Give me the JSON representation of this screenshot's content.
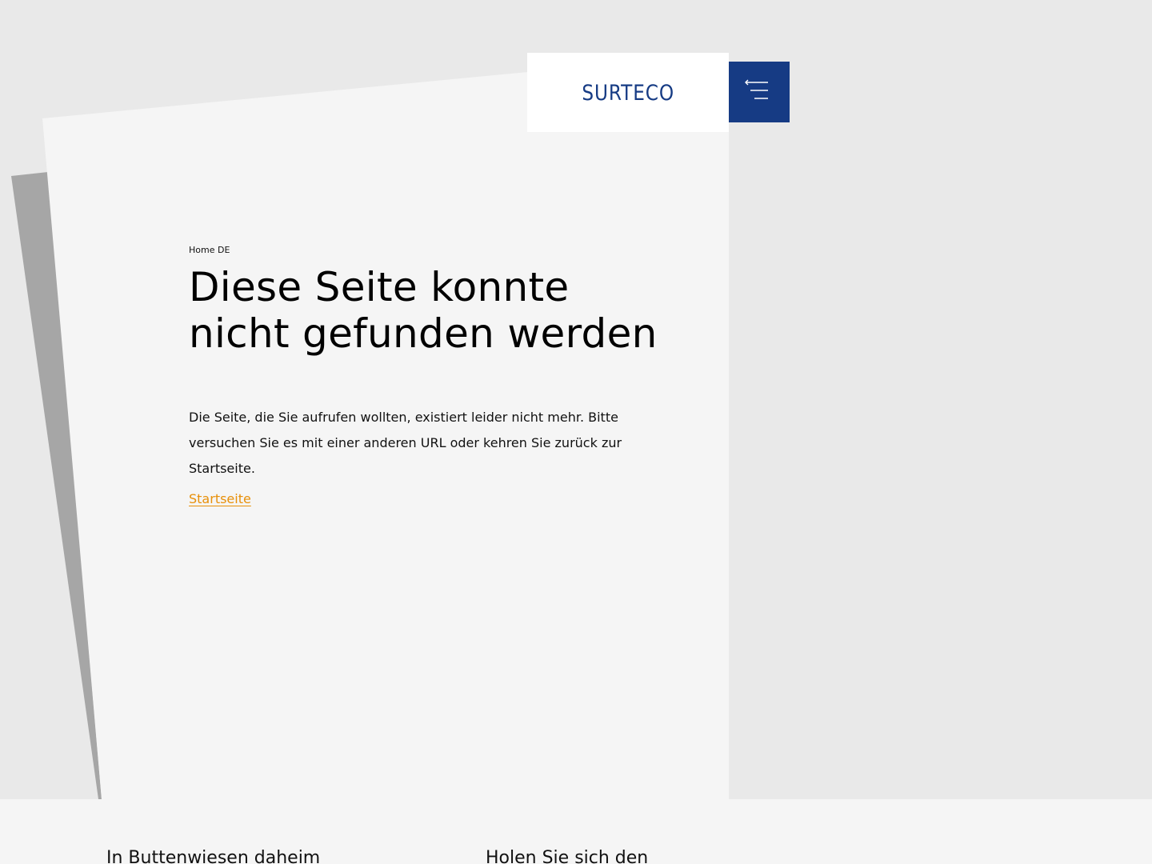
{
  "header": {
    "logo_text": "SURTECO",
    "menu_icon": "menu-lines-icon",
    "brand_color": "#163b84"
  },
  "main": {
    "breadcrumb": "Home DE",
    "title": "Diese Seite konnte nicht gefunden werden",
    "description": "Die Seite, die Sie aufrufen wollten, existiert leider nicht mehr. Bitte versuchen Sie es mit einer anderen URL oder kehren Sie zurück zur Startseite.",
    "home_link": "Startseite",
    "link_color": "#e8900a"
  },
  "footer": {
    "heading_left": "In Buttenwiesen daheim",
    "heading_right": "Holen Sie sich den"
  }
}
